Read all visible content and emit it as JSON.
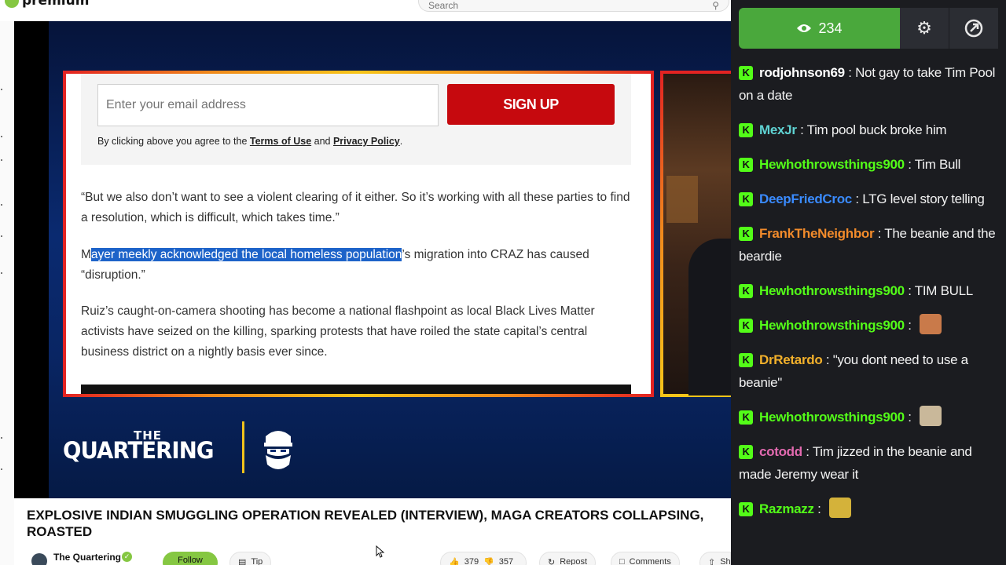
{
  "site": {
    "logo_text": "premium"
  },
  "search": {
    "placeholder": "Search"
  },
  "article": {
    "email_placeholder": "Enter your email address",
    "signup_label": "SIGN UP",
    "terms_prefix": "By clicking above you agree to the ",
    "terms_link": "Terms of Use",
    "terms_mid": " and ",
    "privacy_link": "Privacy Policy",
    "terms_suffix": ".",
    "para1": "“But we also don’t want to see a violent clearing of it either. So it’s working with all these parties to find a resolution, which is difficult, which takes time.”",
    "para2_pre": "M",
    "para2_highlight": "ayer meekly acknowledged the local homeless population",
    "para2_post": "’s migration into CRAZ has caused “disruption.”",
    "para3": "Ruiz’s caught-on-camera shooting has become a national flashpoint as local Black Lives Matter activists have seized on the killing, sparking protests that have roiled the state capital’s central business district on a nightly basis ever since."
  },
  "brand": {
    "the": "THE",
    "name": "QUARTERING"
  },
  "video": {
    "title": "EXPLOSIVE INDIAN SMUGGLING OPERATION REVEALED (INTERVIEW), MAGA CREATORS COLLAPSING, ROASTED",
    "channel": "The Quartering",
    "follow_label": "Follow",
    "tip_label": "Tip",
    "likes": "379",
    "dislikes": "357",
    "repost_label": "Repost",
    "comments_label": "Comments",
    "share_label": "Sh"
  },
  "chat": {
    "viewer_count": "234",
    "messages": [
      {
        "user": "rodjohnson69",
        "color": "#ffffff",
        "text": "Not gay to take Tim Pool on a date"
      },
      {
        "user": "MexJr",
        "color": "#5fd3d3",
        "text": "Tim pool buck broke him"
      },
      {
        "user": "Hewhothrowsthings900",
        "color": "#53fc18",
        "text": "Tim Bull"
      },
      {
        "user": "DeepFriedCroc",
        "color": "#3a8bff",
        "text": "LTG level story telling"
      },
      {
        "user": "FrankTheNeighbor",
        "color": "#f28b2b",
        "text": "The beanie and the beardie"
      },
      {
        "user": "Hewhothrowsthings900",
        "color": "#53fc18",
        "text": "TIM BULL"
      },
      {
        "user": "Hewhothrowsthings900",
        "color": "#53fc18",
        "text": ""
      },
      {
        "user": "DrRetardo",
        "color": "#f2b02b",
        "text": "\"you dont need to use a beanie\""
      },
      {
        "user": "Hewhothrowsthings900",
        "color": "#53fc18",
        "text": ""
      },
      {
        "user": "cotodd",
        "color": "#e36ab0",
        "text": "Tim jizzed in the beanie and made Jeremy wear it"
      },
      {
        "user": "Razmazz",
        "color": "#53fc18",
        "text": ""
      }
    ]
  }
}
